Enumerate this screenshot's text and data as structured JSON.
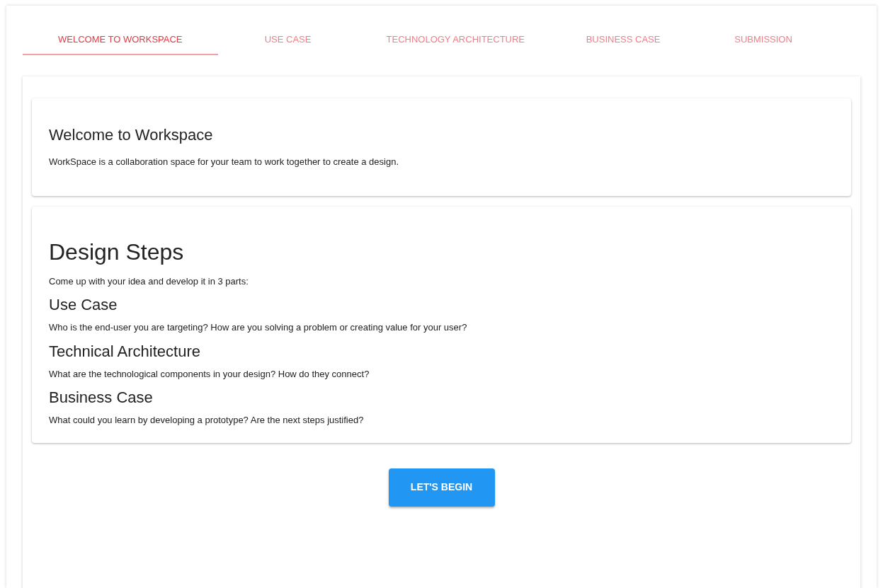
{
  "tabs": [
    {
      "label": "WELCOME TO WORKSPACE",
      "selected": true
    },
    {
      "label": "USE CASE",
      "selected": false
    },
    {
      "label": "TECHNOLOGY ARCHITECTURE",
      "selected": false
    },
    {
      "label": "BUSINESS CASE",
      "selected": false
    },
    {
      "label": "SUBMISSION",
      "selected": false
    }
  ],
  "welcome_card": {
    "title": "Welcome to Workspace",
    "text": "WorkSpace is a collaboration space for your team to work together to create a design."
  },
  "steps_card": {
    "title": "Design Steps",
    "intro": "Come up with your idea and develop it in 3 parts:",
    "sections": [
      {
        "heading": "Use Case",
        "text": "Who is the end-user you are targeting? How are you solving a problem or creating value for your user?"
      },
      {
        "heading": "Technical Architecture",
        "text": "What are the technological components in your design? How do they connect?"
      },
      {
        "heading": "Business Case",
        "text": "What could you learn by developing a prototype? Are the next steps justified?"
      }
    ]
  },
  "begin_button": "LET'S BEGIN"
}
